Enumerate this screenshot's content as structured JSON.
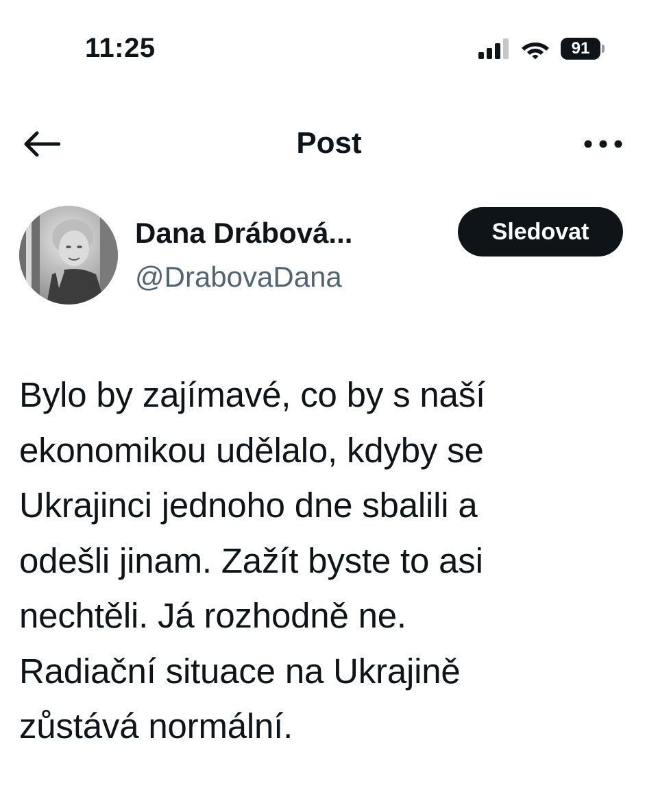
{
  "status_bar": {
    "time": "11:25",
    "battery_level": "91",
    "signal_icon": "cellular-signal-icon",
    "wifi_icon": "wifi-icon"
  },
  "header": {
    "title": "Post",
    "back_icon": "arrow-left-icon",
    "more_icon": "more-horizontal-icon"
  },
  "author": {
    "name": "Dana Drábová...",
    "handle": "@DrabovaDana",
    "follow_label": "Sledovat"
  },
  "post": {
    "text": "Bylo by zajímavé, co by s naší\nekonomikou udělalo, kdyby se\nUkrajinci jednoho dne sbalili a\nodešli jinam. Zažít byste to asi\nnechtěli. Já rozhodně ne.\nRadiační situace na Ukrajině\nzůstává normální."
  },
  "colors": {
    "text_primary": "#0f1419",
    "text_secondary": "#536471",
    "button_bg": "#0f1419",
    "button_text": "#ffffff",
    "background": "#ffffff"
  }
}
